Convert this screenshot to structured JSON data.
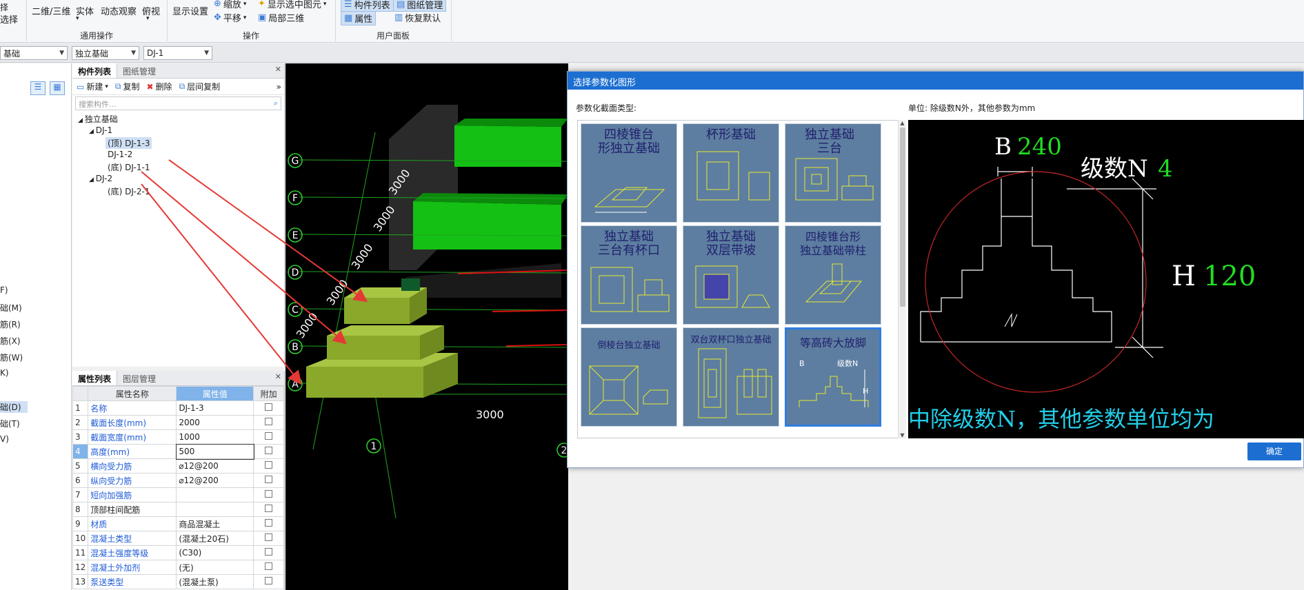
{
  "ribbon": {
    "items": [
      {
        "label": "选择",
        "icon": "select-icon"
      },
      {
        "label": "二维/三维"
      },
      {
        "label": "实体"
      },
      {
        "label": "动态观察"
      },
      {
        "label": "俯视"
      },
      {
        "label": "显示设置"
      },
      {
        "label": "缩放"
      },
      {
        "label": "平移"
      },
      {
        "label": "显示选中图元"
      },
      {
        "label": "局部三维"
      },
      {
        "label": "构件列表"
      },
      {
        "label": "图纸管理"
      },
      {
        "label": "属性"
      },
      {
        "label": "恢复默认"
      }
    ],
    "groups": [
      "通用操作",
      "操作",
      "用户面板"
    ]
  },
  "dropdowns": [
    "基础",
    "独立基础",
    "DJ-1"
  ],
  "left_strip": {
    "items": [
      "F)",
      "础(M)",
      "筋(R)",
      "筋(X)",
      "筋(W)",
      "K)",
      "础(D)",
      "础(T)",
      "V)"
    ]
  },
  "component_panel": {
    "tabs": [
      "构件列表",
      "图纸管理"
    ],
    "toolbar": [
      "新建",
      "复制",
      "删除",
      "层间复制"
    ],
    "search_placeholder": "搜索构件...",
    "tree": {
      "root": "独立基础",
      "dj1": "DJ-1",
      "dj1_3": "(顶)  DJ-1-3",
      "dj1_2": "DJ-1-2",
      "dj1_1": "(底)  DJ-1-1",
      "dj2": "DJ-2",
      "dj2_1": "(底)  DJ-2-1"
    }
  },
  "property_panel": {
    "tabs": [
      "属性列表",
      "图层管理"
    ],
    "headers": [
      "属性名称",
      "属性值",
      "附加"
    ],
    "rows": [
      {
        "n": "1",
        "name": "名称",
        "value": "DJ-1-3"
      },
      {
        "n": "2",
        "name": "截面长度(mm)",
        "value": "2000"
      },
      {
        "n": "3",
        "name": "截面宽度(mm)",
        "value": "1000"
      },
      {
        "n": "4",
        "name": "高度(mm)",
        "value": "500"
      },
      {
        "n": "5",
        "name": "横向受力筋",
        "value": "⌀12@200"
      },
      {
        "n": "6",
        "name": "纵向受力筋",
        "value": "⌀12@200"
      },
      {
        "n": "7",
        "name": "短向加强筋",
        "value": ""
      },
      {
        "n": "8",
        "name": "顶部柱间配筋",
        "value": ""
      },
      {
        "n": "9",
        "name": "材质",
        "value": "商品混凝土"
      },
      {
        "n": "10",
        "name": "混凝土类型",
        "value": "(混凝土20石)"
      },
      {
        "n": "11",
        "name": "混凝土强度等级",
        "value": "(C30)"
      },
      {
        "n": "12",
        "name": "混凝土外加剂",
        "value": "(无)"
      },
      {
        "n": "13",
        "name": "泵送类型",
        "value": "(混凝土泵)"
      }
    ]
  },
  "view3d": {
    "axis_letters": [
      "G",
      "F",
      "E",
      "D",
      "C",
      "B",
      "A"
    ],
    "dims": [
      "3000",
      "3000",
      "3000",
      "3000",
      "3000",
      "3000"
    ],
    "bottom_axis": [
      "1",
      "2"
    ]
  },
  "dialog": {
    "title": "选择参数化图形",
    "section_label": "参数化截面类型:",
    "unit_label": "单位:   除级数N外，其他参数为mm",
    "tiles": [
      "四棱锥台形独立基础",
      "杯形基础",
      "独立基础三台",
      "独立基础三台有杯口",
      "独立基础双层带坡",
      "四棱锥台形独立基础带柱",
      "倒棱台独立基础",
      "双台双杯口独立基础",
      "等高砖大放脚"
    ],
    "tile_lines": {
      "t0a": "四棱锥台",
      "t0b": "形独立基础",
      "t2a": "独立基础",
      "t2b": "三台",
      "t3a": "独立基础",
      "t3b": "三台有杯口",
      "t4a": "独立基础",
      "t4b": "双层带坡",
      "t5a": "四棱锥台形",
      "t5b": "独立基础带柱"
    },
    "preview": {
      "b_label": "B",
      "b_value": "240",
      "n_label": "级数N",
      "n_value": "4",
      "h_label": "H",
      "h_value": "120",
      "bottom_text": "中除级数N，其他参数单位均为"
    },
    "ok_label": "确定"
  },
  "colors": {
    "accent": "#1c6fd1",
    "green": "#22dd22",
    "foundation": "#8aa92a"
  }
}
